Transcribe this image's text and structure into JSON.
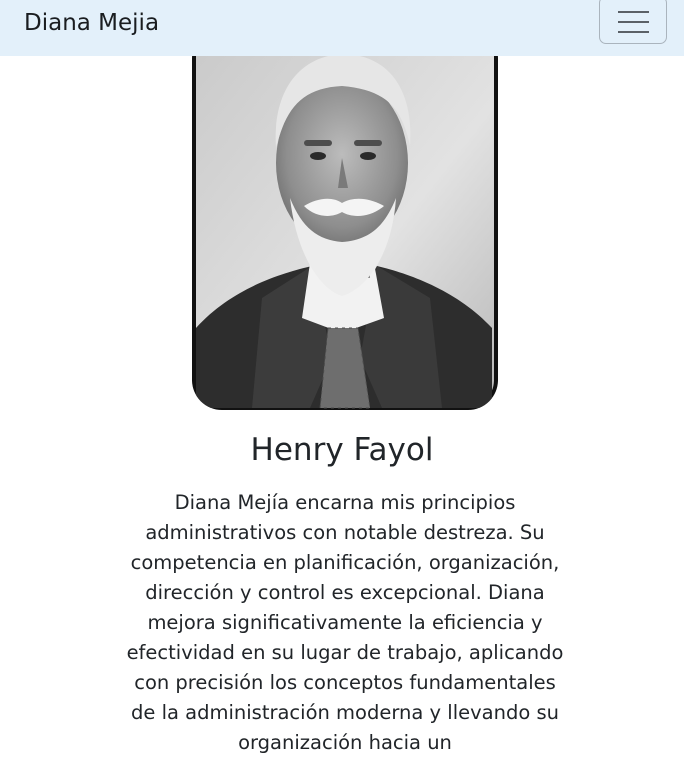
{
  "navbar": {
    "brand": "Diana Mejia",
    "toggler_icon": "hamburger-menu-icon"
  },
  "testimonial": {
    "photo_subject": "Henry Fayol",
    "name": "Henry Fayol",
    "text": "Diana Mejía encarna mis principios administrativos con notable destreza. Su competencia en planificación, organización, dirección y control es excepcional. Diana mejora significativamente la eficiencia y efectividad en su lugar de trabajo, aplicando con precisión los conceptos fundamentales de la administración moderna y llevando su organización hacia un"
  },
  "colors": {
    "navbar_bg": "#e3f0fa",
    "text": "#212529"
  }
}
